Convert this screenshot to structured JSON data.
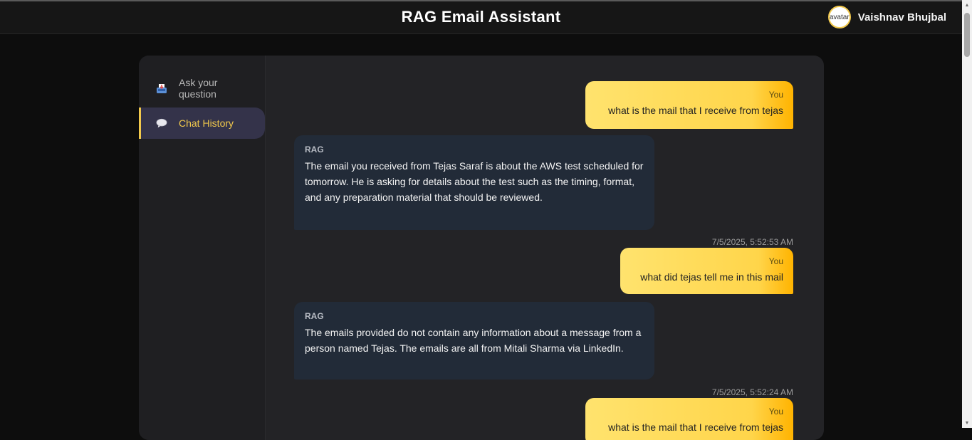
{
  "header": {
    "title": "RAG Email Assistant",
    "avatar_alt": "avatar",
    "user_name": "Vaishnav Bhujbal"
  },
  "sidebar": {
    "items": [
      {
        "label": "Ask your question",
        "icon": "inbox-tray-icon",
        "active": false
      },
      {
        "label": "Chat History",
        "icon": "speech-balloon-icon",
        "active": true
      }
    ]
  },
  "chat": {
    "messages": [
      {
        "sender": "You",
        "text": "what is the mail that I receive from tejas"
      },
      {
        "sender": "RAG",
        "text": "The email you received from Tejas Saraf is about the AWS test scheduled for tomorrow. He is asking for details about the test such as the timing, format, and any preparation material that should be reviewed."
      },
      {
        "timestamp": "7/5/2025, 5:52:53 AM"
      },
      {
        "sender": "You",
        "text": "what did tejas tell me in this mail"
      },
      {
        "sender": "RAG",
        "text": "The emails provided do not contain any information about a message from a person named Tejas. The emails are all from Mitali Sharma via LinkedIn."
      },
      {
        "timestamp": "7/5/2025, 5:52:24 AM"
      },
      {
        "sender": "You",
        "text": "what is the mail that I receive from tejas"
      }
    ]
  },
  "colors": {
    "accent": "#f2c94c",
    "user_bubble": "#ffd54a",
    "rag_bubble": "#222b38",
    "panel": "#232326",
    "background": "#0d0d0d"
  }
}
